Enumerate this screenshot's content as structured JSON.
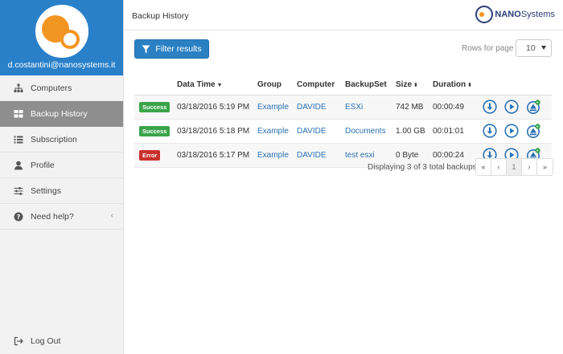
{
  "user": {
    "email": "d.costantini@nanosystems.it"
  },
  "sidebar": {
    "items": [
      {
        "label": "Computers",
        "icon": "sitemap-icon"
      },
      {
        "label": "Backup History",
        "icon": "grid-icon",
        "active": true
      },
      {
        "label": "Subscription",
        "icon": "list-icon"
      },
      {
        "label": "Profile",
        "icon": "user-icon"
      },
      {
        "label": "Settings",
        "icon": "sliders-icon"
      },
      {
        "label": "Need help?",
        "icon": "question-icon"
      }
    ],
    "logout_label": "Log Out"
  },
  "header": {
    "title": "Backup History",
    "logo_bold": "NANO",
    "logo_regular": "Systems"
  },
  "toolbar": {
    "filter_label": "Filter results",
    "rows_label": "Rows for page",
    "rows_value": "10"
  },
  "table": {
    "columns": [
      "",
      "Data Time",
      "Group",
      "Computer",
      "BackupSet",
      "Size",
      "Duration",
      ""
    ],
    "rows": [
      {
        "status": "Success",
        "datetime": "03/18/2016 5:19 PM",
        "group": "Example",
        "computer": "DAVIDE",
        "backupset": "ESXi",
        "size": "742 MB",
        "duration": "00:00:49"
      },
      {
        "status": "Success",
        "datetime": "03/18/2016 5:18 PM",
        "group": "Example",
        "computer": "DAVIDE",
        "backupset": "Documents",
        "size": "1.00 GB",
        "duration": "00:01:01"
      },
      {
        "status": "Error",
        "datetime": "03/18/2016 5:17 PM",
        "group": "Example",
        "computer": "DAVIDE",
        "backupset": "test esxi",
        "size": "0 Byte",
        "duration": "00:00:24"
      }
    ]
  },
  "footer": {
    "display_info": "Displaying 3 of 3 total backups",
    "pager": [
      "«",
      "‹",
      "1",
      "›",
      "»"
    ],
    "current_page": "1"
  },
  "colors": {
    "primary": "#2a80c3",
    "profile_bg": "#2980c9",
    "success": "#3aa44a",
    "error": "#c9302c",
    "accent_orange": "#f39522"
  }
}
